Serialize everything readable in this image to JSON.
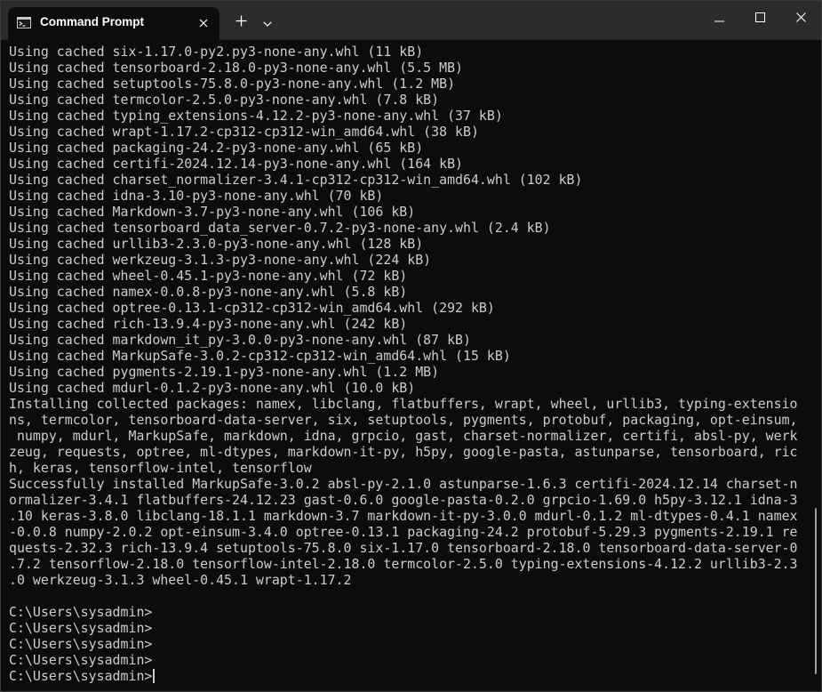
{
  "window": {
    "tab_title": "Command Prompt",
    "tab_icon": "cmd-icon",
    "tab_close_icon": "close-icon",
    "new_tab_icon": "plus-icon",
    "dropdown_icon": "chevron-down-icon",
    "minimize_icon": "minimize-icon",
    "maximize_icon": "maximize-icon",
    "close_icon": "close-icon"
  },
  "terminal": {
    "lines": [
      "Using cached six-1.17.0-py2.py3-none-any.whl (11 kB)",
      "Using cached tensorboard-2.18.0-py3-none-any.whl (5.5 MB)",
      "Using cached setuptools-75.8.0-py3-none-any.whl (1.2 MB)",
      "Using cached termcolor-2.5.0-py3-none-any.whl (7.8 kB)",
      "Using cached typing_extensions-4.12.2-py3-none-any.whl (37 kB)",
      "Using cached wrapt-1.17.2-cp312-cp312-win_amd64.whl (38 kB)",
      "Using cached packaging-24.2-py3-none-any.whl (65 kB)",
      "Using cached certifi-2024.12.14-py3-none-any.whl (164 kB)",
      "Using cached charset_normalizer-3.4.1-cp312-cp312-win_amd64.whl (102 kB)",
      "Using cached idna-3.10-py3-none-any.whl (70 kB)",
      "Using cached Markdown-3.7-py3-none-any.whl (106 kB)",
      "Using cached tensorboard_data_server-0.7.2-py3-none-any.whl (2.4 kB)",
      "Using cached urllib3-2.3.0-py3-none-any.whl (128 kB)",
      "Using cached werkzeug-3.1.3-py3-none-any.whl (224 kB)",
      "Using cached wheel-0.45.1-py3-none-any.whl (72 kB)",
      "Using cached namex-0.0.8-py3-none-any.whl (5.8 kB)",
      "Using cached optree-0.13.1-cp312-cp312-win_amd64.whl (292 kB)",
      "Using cached rich-13.9.4-py3-none-any.whl (242 kB)",
      "Using cached markdown_it_py-3.0.0-py3-none-any.whl (87 kB)",
      "Using cached MarkupSafe-3.0.2-cp312-cp312-win_amd64.whl (15 kB)",
      "Using cached pygments-2.19.1-py3-none-any.whl (1.2 MB)",
      "Using cached mdurl-0.1.2-py3-none-any.whl (10.0 kB)",
      "Installing collected packages: namex, libclang, flatbuffers, wrapt, wheel, urllib3, typing-extensio",
      "ns, termcolor, tensorboard-data-server, six, setuptools, pygments, protobuf, packaging, opt-einsum,",
      " numpy, mdurl, MarkupSafe, markdown, idna, grpcio, gast, charset-normalizer, certifi, absl-py, werk",
      "zeug, requests, optree, ml-dtypes, markdown-it-py, h5py, google-pasta, astunparse, tensorboard, ric",
      "h, keras, tensorflow-intel, tensorflow",
      "Successfully installed MarkupSafe-3.0.2 absl-py-2.1.0 astunparse-1.6.3 certifi-2024.12.14 charset-n",
      "ormalizer-3.4.1 flatbuffers-24.12.23 gast-0.6.0 google-pasta-0.2.0 grpcio-1.69.0 h5py-3.12.1 idna-3",
      ".10 keras-3.8.0 libclang-18.1.1 markdown-3.7 markdown-it-py-3.0.0 mdurl-0.1.2 ml-dtypes-0.4.1 namex",
      "-0.0.8 numpy-2.0.2 opt-einsum-3.4.0 optree-0.13.1 packaging-24.2 protobuf-5.29.3 pygments-2.19.1 re",
      "quests-2.32.3 rich-13.9.4 setuptools-75.8.0 six-1.17.0 tensorboard-2.18.0 tensorboard-data-server-0",
      ".7.2 tensorflow-2.18.0 tensorflow-intel-2.18.0 termcolor-2.5.0 typing-extensions-4.12.2 urllib3-2.3",
      ".0 werkzeug-3.1.3 wheel-0.45.1 wrapt-1.17.2",
      "",
      "C:\\Users\\sysadmin>",
      "C:\\Users\\sysadmin>",
      "C:\\Users\\sysadmin>",
      "C:\\Users\\sysadmin>"
    ],
    "active_prompt": "C:\\Users\\sysadmin>"
  }
}
